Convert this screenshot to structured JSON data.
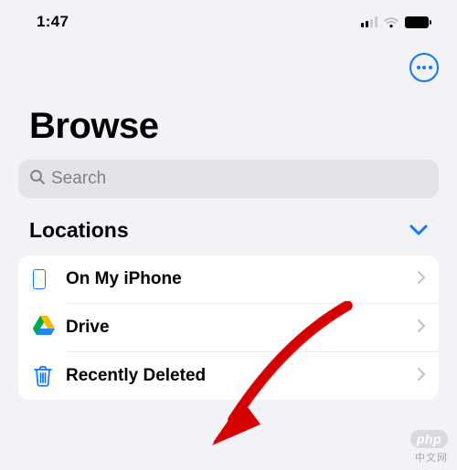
{
  "status": {
    "time": "1:47"
  },
  "nav": {
    "more_label": "More"
  },
  "page": {
    "title": "Browse"
  },
  "search": {
    "placeholder": "Search"
  },
  "section": {
    "title": "Locations"
  },
  "rows": [
    {
      "label": "On My iPhone"
    },
    {
      "label": "Drive"
    },
    {
      "label": "Recently Deleted"
    }
  ],
  "watermark": {
    "logo": "php",
    "text": "中文网"
  },
  "colors": {
    "accent": "#0a7aff"
  }
}
